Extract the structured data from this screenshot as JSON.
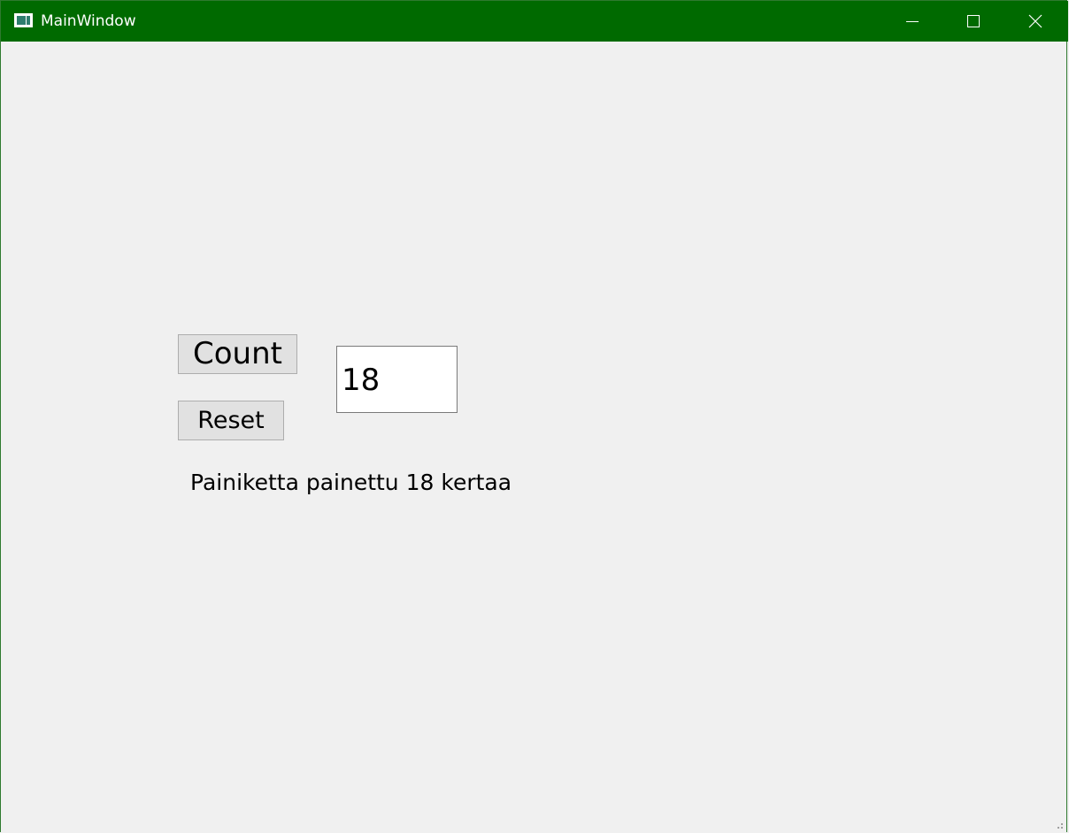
{
  "window": {
    "title": "MainWindow",
    "titlebar_color": "#006a00",
    "icons": [
      "app-icon",
      "minimize-icon",
      "maximize-icon",
      "close-icon"
    ]
  },
  "main": {
    "count_button_label": "Count",
    "reset_button_label": "Reset",
    "count_value": "18",
    "status_message": "Painiketta painettu 18 kertaa"
  }
}
